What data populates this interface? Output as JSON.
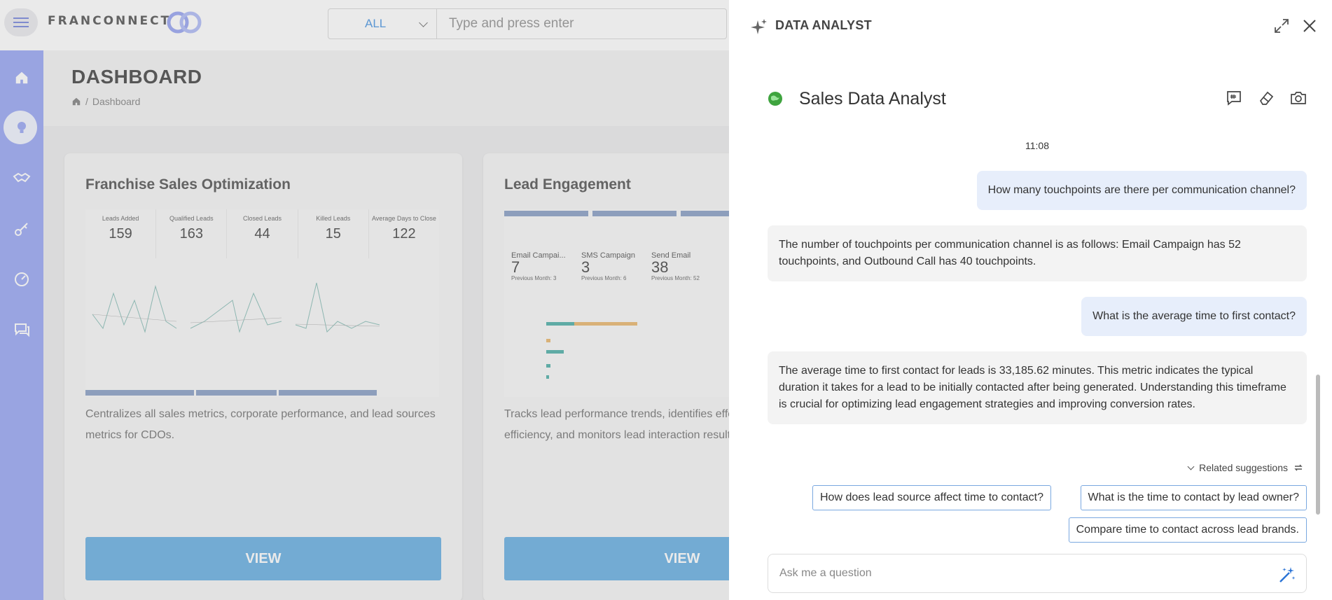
{
  "header": {
    "logo_text": "FRANCONNECT",
    "search_scope": "ALL",
    "search_placeholder": "Type and press enter"
  },
  "sidebar": {
    "items": [
      {
        "icon": "home-icon"
      },
      {
        "icon": "lightbulb-icon",
        "active": true
      },
      {
        "icon": "handshake-icon"
      },
      {
        "icon": "key-icon"
      },
      {
        "icon": "gauge-icon"
      },
      {
        "icon": "chat-icon"
      }
    ]
  },
  "page": {
    "title": "DASHBOARD",
    "breadcrumb": "Dashboard"
  },
  "cards": [
    {
      "title": "Franchise Sales Optimization",
      "description": "Centralizes all sales metrics, corporate performance, and lead sources metrics for CDOs.",
      "button": "VIEW",
      "kpis": [
        {
          "label": "Leads Added",
          "value": "159"
        },
        {
          "label": "Qualified Leads",
          "value": "163"
        },
        {
          "label": "Closed Leads",
          "value": "44"
        },
        {
          "label": "Killed Leads",
          "value": "15"
        },
        {
          "label": "Average Days to Close",
          "value": "122"
        }
      ]
    },
    {
      "title": "Lead Engagement",
      "description": "Tracks lead performance trends, identifies effective sales team efficiency, and monitors lead interaction results.",
      "button": "VIEW",
      "kpis": [
        {
          "label": "Email Campai...",
          "value": "7",
          "sub": "Previous Month: 3"
        },
        {
          "label": "SMS Campaign",
          "value": "3",
          "sub": "Previous Month: 6"
        },
        {
          "label": "Send Email",
          "value": "38",
          "sub": "Previous Month: 52"
        }
      ]
    }
  ],
  "panel": {
    "title": "DATA ANALYST",
    "subtitle": "Sales Data Analyst",
    "time": "11:08",
    "messages": [
      {
        "role": "user",
        "text": "How many touchpoints are there per communication channel?"
      },
      {
        "role": "assistant",
        "text": "The number of touchpoints per communication channel is as follows: Email Campaign has 52 touchpoints, and Outbound Call has 40 touchpoints."
      },
      {
        "role": "user",
        "text": "What is the average time to first contact?"
      },
      {
        "role": "assistant",
        "text": "The average time to first contact for leads is 33,185.62 minutes. This metric indicates the typical duration it takes for a lead to be initially contacted after being generated. Understanding this timeframe is crucial for optimizing lead engagement strategies and improving conversion rates."
      }
    ],
    "related_label": "Related suggestions",
    "suggestions": [
      "How does lead source affect time to contact?",
      "What is the time to contact by lead owner?",
      "Compare time to contact across lead brands."
    ],
    "input_placeholder": "Ask me a question"
  }
}
